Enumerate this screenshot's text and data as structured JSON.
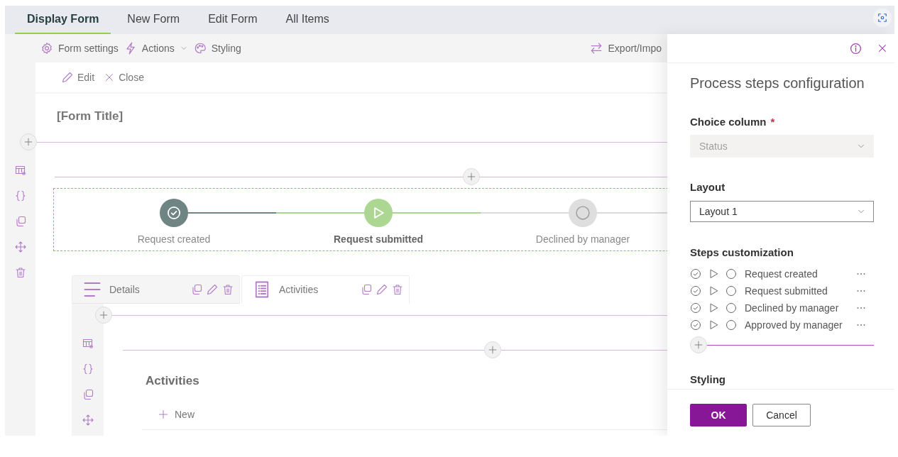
{
  "tabs": [
    {
      "label": "Display Form",
      "selected": true
    },
    {
      "label": "New Form",
      "selected": false
    },
    {
      "label": "Edit Form",
      "selected": false
    },
    {
      "label": "All Items",
      "selected": false
    }
  ],
  "toolbar": {
    "items": [
      {
        "label": "Form settings",
        "dropdown": false
      },
      {
        "label": "Actions",
        "dropdown": true
      },
      {
        "label": "Styling",
        "dropdown": false
      }
    ],
    "right_item": "Export/Impo"
  },
  "command_bar": [
    "Edit",
    "Close"
  ],
  "form_title": "[Form Title]",
  "process_steps": [
    {
      "label": "Request created",
      "kind": "completed"
    },
    {
      "label": "Request submitted",
      "kind": "current"
    },
    {
      "label": "Declined by manager",
      "kind": "pending"
    }
  ],
  "container_tabs": [
    {
      "label": "Details",
      "selected": false
    },
    {
      "label": "Activities",
      "selected": true
    }
  ],
  "activities": {
    "title": "Activities",
    "new_button": "New"
  },
  "panel": {
    "title": "Process steps configuration",
    "choice_column": {
      "label": "Choice column",
      "required": true,
      "required_mark": "*",
      "value": "Status",
      "disabled": true
    },
    "layout": {
      "label": "Layout",
      "value": "Layout 1",
      "disabled": false
    },
    "steps_customization": {
      "label": "Steps customization",
      "steps": [
        "Request created",
        "Request submitted",
        "Declined by manager",
        "Approved by manager"
      ]
    },
    "styling_label": "Styling",
    "buttons": {
      "ok": "OK",
      "cancel": "Cancel"
    }
  }
}
